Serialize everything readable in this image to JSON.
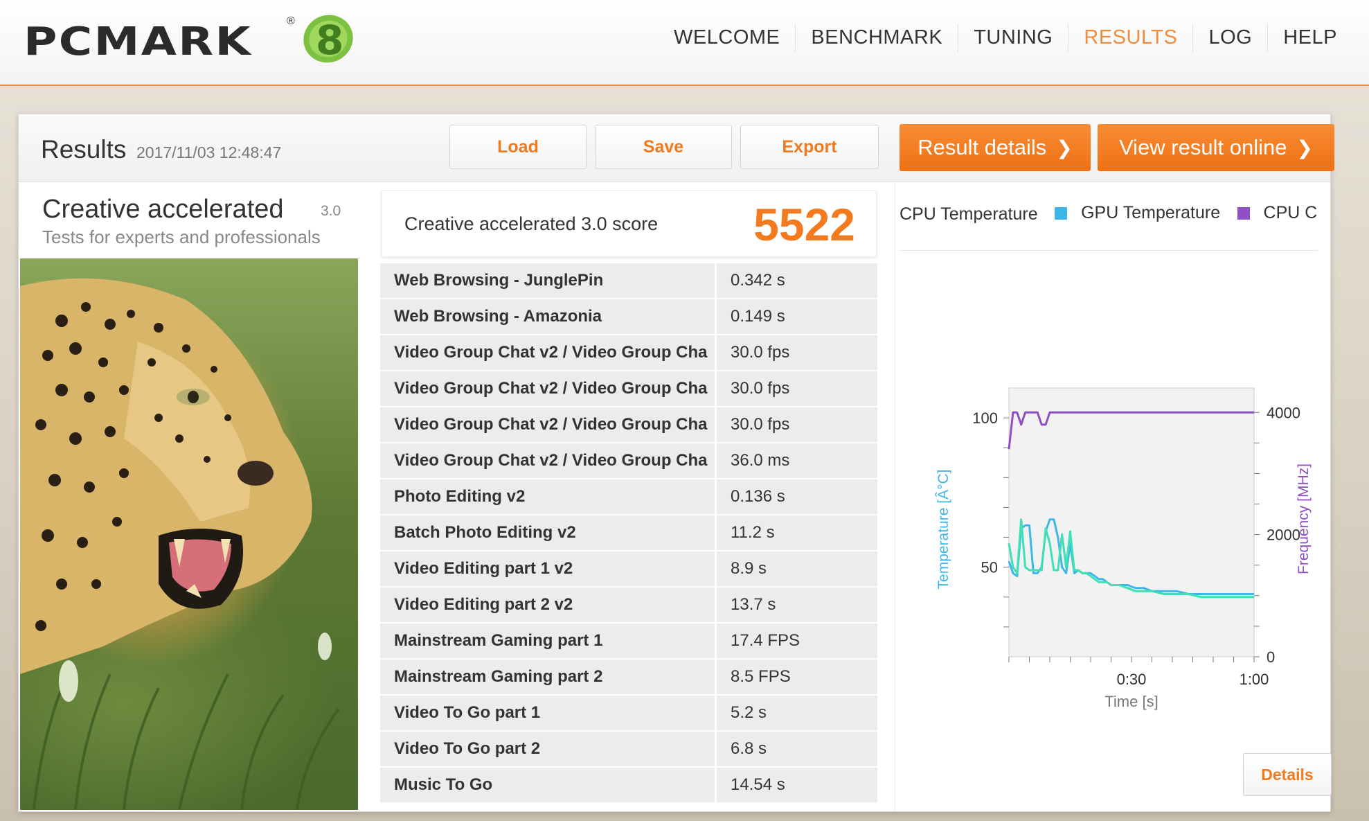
{
  "app": {
    "logo_text": "PCMARK",
    "logo_reg": "®",
    "logo_eight": "8"
  },
  "nav": [
    {
      "label": "WELCOME",
      "active": false
    },
    {
      "label": "BENCHMARK",
      "active": false
    },
    {
      "label": "TUNING",
      "active": false
    },
    {
      "label": "RESULTS",
      "active": true
    },
    {
      "label": "LOG",
      "active": false
    },
    {
      "label": "HELP",
      "active": false
    }
  ],
  "results": {
    "title": "Results",
    "date": "2017/11/03 12:48:47",
    "load_label": "Load",
    "save_label": "Save",
    "export_label": "Export",
    "details_label": "Result details",
    "online_label": "View result online",
    "chevron": "❯"
  },
  "test": {
    "name": "Creative accelerated",
    "version": "3.0",
    "subtitle": "Tests for experts and professionals",
    "image": "leopard-photo"
  },
  "score": {
    "label": "Creative accelerated 3.0 score",
    "value": "5522"
  },
  "rows": [
    {
      "name": "Web Browsing - JunglePin",
      "value": "0.342 s"
    },
    {
      "name": "Web Browsing - Amazonia",
      "value": "0.149 s"
    },
    {
      "name": "Video Group Chat v2 / Video Group Cha",
      "value": "30.0 fps"
    },
    {
      "name": "Video Group Chat v2 / Video Group Cha",
      "value": "30.0 fps"
    },
    {
      "name": "Video Group Chat v2 / Video Group Cha",
      "value": "30.0 fps"
    },
    {
      "name": "Video Group Chat v2 / Video Group Cha",
      "value": "36.0 ms"
    },
    {
      "name": "Photo Editing v2",
      "value": "0.136 s"
    },
    {
      "name": "Batch Photo Editing v2",
      "value": "11.2 s"
    },
    {
      "name": "Video Editing part 1 v2",
      "value": "8.9 s"
    },
    {
      "name": "Video Editing part 2 v2",
      "value": "13.7 s"
    },
    {
      "name": "Mainstream Gaming part 1",
      "value": "17.4 FPS"
    },
    {
      "name": "Mainstream Gaming part 2",
      "value": "8.5 FPS"
    },
    {
      "name": "Video To Go part 1",
      "value": "5.2 s"
    },
    {
      "name": "Video To Go part 2",
      "value": "6.8 s"
    },
    {
      "name": "Music To Go",
      "value": "14.54 s"
    }
  ],
  "monitor": {
    "details_label": "Details",
    "legend": [
      {
        "label": "CPU Temperature",
        "color": "#3db6e8"
      },
      {
        "label": "GPU Temperature",
        "color": "#3db6e8"
      },
      {
        "label": "CPU Clo",
        "color": "#8e4ec6"
      }
    ]
  },
  "chart_data": {
    "type": "line",
    "xlabel": "Time [s]",
    "ylabel_left": "Temperature [Â°C]",
    "ylabel_right": "Frequency [MHz]",
    "x_ticks": [
      "0:30",
      "1:00"
    ],
    "y_left_ticks": [
      "50",
      "100"
    ],
    "y_right_ticks": [
      "0",
      "2000",
      "4000"
    ],
    "xlim": [
      0,
      60
    ],
    "ylim_left": [
      20,
      110
    ],
    "ylim_right": [
      0,
      4400
    ],
    "grid": true,
    "series": [
      {
        "axis": "right",
        "color": "#8e4ec6",
        "x": [
          0,
          1,
          2,
          3,
          4,
          5,
          6,
          7,
          8,
          9,
          10,
          11,
          12,
          13,
          14,
          15,
          16,
          17,
          18,
          20,
          25,
          30,
          40,
          50,
          60
        ],
        "y": [
          3400,
          4000,
          4000,
          3800,
          4000,
          4000,
          4000,
          4000,
          3800,
          3800,
          4000,
          4000,
          4000,
          4000,
          4000,
          4000,
          4000,
          4000,
          4000,
          4000,
          4000,
          4000,
          4000,
          4000,
          4000
        ]
      },
      {
        "axis": "left",
        "color": "#3db6e8",
        "x": [
          0,
          1,
          2,
          3,
          4,
          5,
          6,
          7,
          8,
          9,
          10,
          11,
          12,
          13,
          14,
          15,
          16,
          17,
          18,
          19,
          20,
          21,
          22,
          23,
          24,
          25,
          27,
          29,
          31,
          33,
          35,
          38,
          41,
          44,
          47,
          50,
          53,
          56,
          60
        ],
        "y": [
          52,
          48,
          47,
          63,
          64,
          64,
          48,
          48,
          50,
          62,
          66,
          66,
          60,
          50,
          48,
          58,
          48,
          49,
          48,
          48,
          48,
          47,
          46,
          46,
          45,
          44,
          44,
          44,
          43,
          43,
          42,
          42,
          42,
          41,
          41,
          41,
          41,
          41,
          41
        ]
      },
      {
        "axis": "left",
        "color": "#3ee0b4",
        "x": [
          0,
          1,
          2,
          3,
          4,
          5,
          6,
          7,
          8,
          9,
          10,
          11,
          12,
          13,
          14,
          15,
          16,
          17,
          18,
          19,
          20,
          21,
          22,
          23,
          24,
          25,
          27,
          29,
          31,
          33,
          35,
          38,
          41,
          44,
          47,
          50,
          53,
          56,
          60
        ],
        "y": [
          58,
          50,
          48,
          66,
          50,
          49,
          49,
          49,
          49,
          63,
          58,
          49,
          49,
          61,
          50,
          62,
          49,
          49,
          48,
          48,
          47,
          46,
          45,
          45,
          45,
          44,
          44,
          43,
          42,
          42,
          42,
          41,
          41,
          41,
          40,
          40,
          40,
          40,
          40
        ]
      }
    ]
  }
}
